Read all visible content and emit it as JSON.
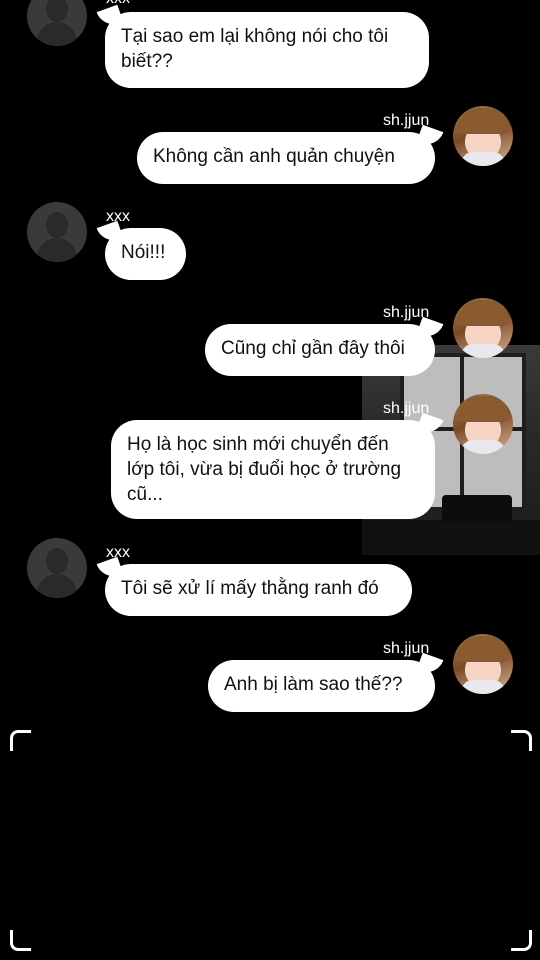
{
  "participants": {
    "other": {
      "name": "xxx",
      "avatar_icon": "default-user-silhouette-icon"
    },
    "me": {
      "name": "sh.jjun",
      "avatar_icon": "profile-photo-avatar"
    }
  },
  "messages": [
    {
      "sender": "xxx",
      "text": "Tại sao em lại không nói cho tôi\nbiết??"
    },
    {
      "sender": "sh.jjun",
      "text": "Không cần anh quản chuyện"
    },
    {
      "sender": "xxx",
      "text": "Nói!!!"
    },
    {
      "sender": "sh.jjun",
      "text": "Cũng chỉ gần đây thôi"
    },
    {
      "sender": "sh.jjun",
      "text": "Họ là học sinh mới chuyển đến\nlớp tôi, vừa bị đuổi học ở trường\ncũ..."
    },
    {
      "sender": "xxx",
      "text": "Tôi sẽ xử lí mấy thằng ranh đó"
    },
    {
      "sender": "sh.jjun",
      "text": "Anh bị làm sao thế??"
    }
  ],
  "colors": {
    "background": "#000000",
    "bubble": "#ffffff",
    "text": "#111111"
  }
}
